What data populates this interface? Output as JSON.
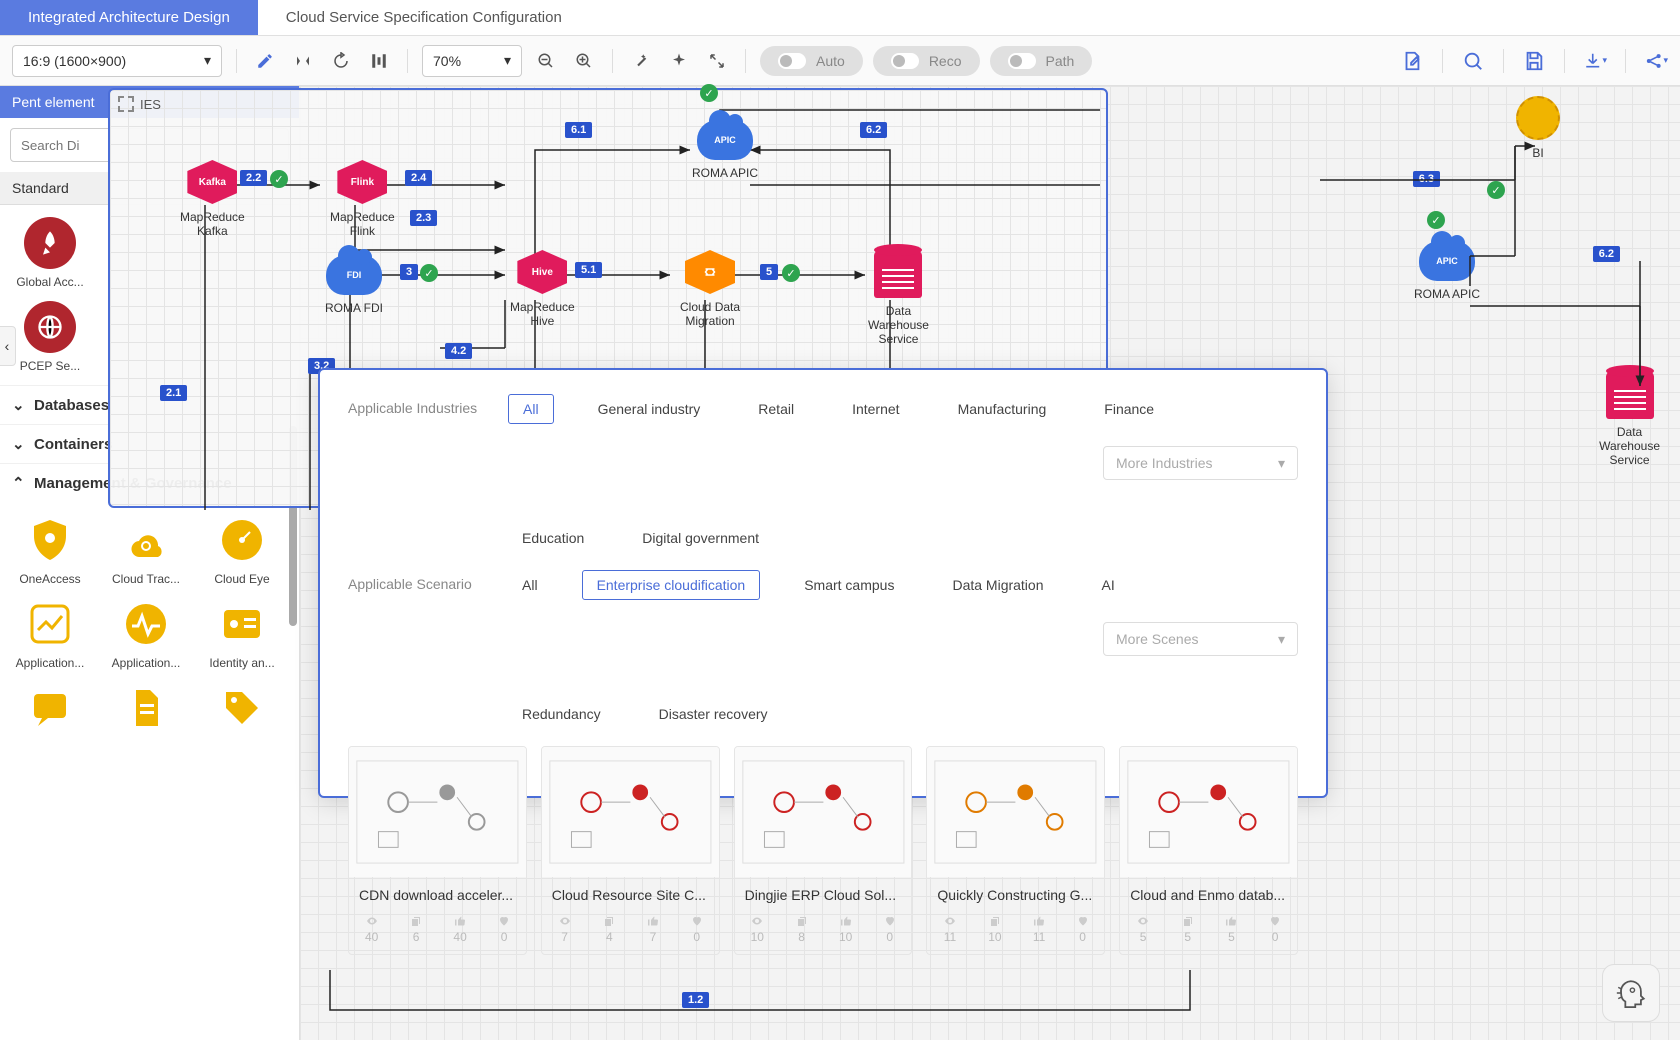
{
  "tabs": {
    "design": "Integrated Architecture Design",
    "config": "Cloud Service Specification Configuration"
  },
  "toolbar": {
    "ratio": "16:9 (1600×900)",
    "zoom": "70%",
    "auto": "Auto",
    "reco": "Reco",
    "path": "Path"
  },
  "sidebar": {
    "header": "Pent element",
    "search_placeholder": "Search Di",
    "standard_tab": "Standard",
    "items_top": [
      {
        "label": "Global Acc..."
      },
      {
        "label": "PCEP Se..."
      }
    ],
    "cat_db": "Databases",
    "cat_containers": "Containers",
    "cat_mgmt": "Management & Governance",
    "mgmt_items": [
      {
        "label": "OneAccess"
      },
      {
        "label": "Cloud Trac..."
      },
      {
        "label": "Cloud Eye"
      },
      {
        "label": "Application..."
      },
      {
        "label": "Application..."
      },
      {
        "label": "Identity an..."
      }
    ]
  },
  "diagram": {
    "frame_title": "IES",
    "nodes": {
      "kafka": "MapReduce\nKafka",
      "kafka_icon": "Kafka",
      "flink": "MapReduce\nFlink",
      "flink_icon": "Flink",
      "hive": "MapReduce\nHive",
      "hive_icon": "Hive",
      "fdi": "ROMA FDI",
      "fdi_icon": "FDI",
      "cdm": "Cloud Data\nMigration",
      "dws": "Data\nWarehouse\nService",
      "apic": "ROMA APIC",
      "apic_icon": "APIC",
      "bi": "BI"
    },
    "badges": {
      "b21": "2.1",
      "b22": "2.2",
      "b23": "2.3",
      "b24": "2.4",
      "b3": "3",
      "b32": "3.2",
      "b42": "4.2",
      "b5": "5",
      "b51": "5.1",
      "b61": "6.1",
      "b62": "6.2",
      "b63": "6.3",
      "b12": "1.2"
    }
  },
  "filter": {
    "label_ind": "Applicable Industries",
    "label_scen": "Applicable Scenario",
    "ind": [
      "All",
      "General industry",
      "Retail",
      "Internet",
      "Manufacturing",
      "Finance",
      "Education",
      "Digital government"
    ],
    "scen": [
      "All",
      "Enterprise cloudification",
      "Smart campus",
      "Data Migration",
      "AI",
      "Redundancy",
      "Disaster recovery"
    ],
    "more_ind": "More Industries",
    "more_scen": "More Scenes"
  },
  "cards": [
    {
      "title": "CDN download acceler...",
      "views": "40",
      "copies": "6",
      "likes": "40",
      "favs": "0"
    },
    {
      "title": "Cloud Resource Site C...",
      "views": "7",
      "copies": "4",
      "likes": "7",
      "favs": "0"
    },
    {
      "title": "Dingjie ERP Cloud Sol...",
      "views": "10",
      "copies": "8",
      "likes": "10",
      "favs": "0"
    },
    {
      "title": "Quickly Constructing G...",
      "views": "11",
      "copies": "10",
      "likes": "11",
      "favs": "0"
    },
    {
      "title": "Cloud and Enmo datab...",
      "views": "5",
      "copies": "5",
      "likes": "5",
      "favs": "0"
    }
  ]
}
